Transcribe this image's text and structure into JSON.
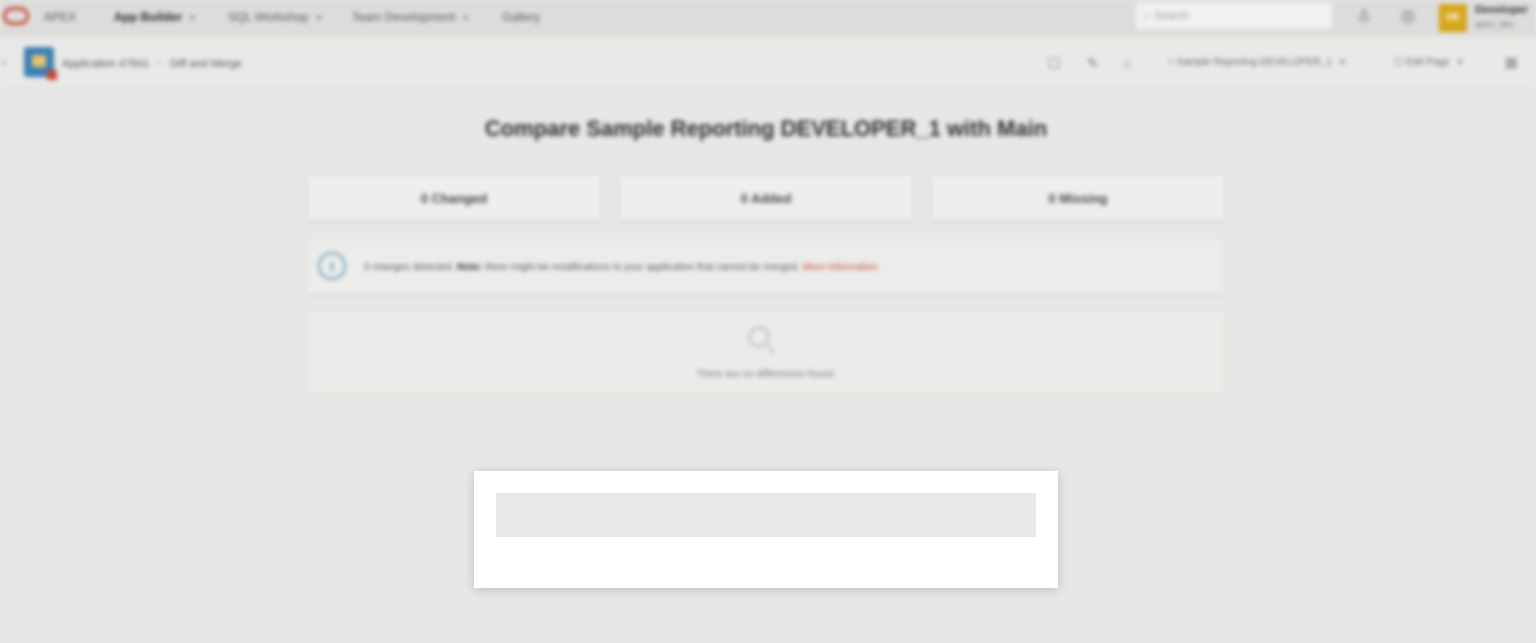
{
  "topnav": {
    "brand": "APEX",
    "items": [
      {
        "label": "App Builder",
        "active": true
      },
      {
        "label": "SQL Workshop",
        "active": false
      },
      {
        "label": "Team Development",
        "active": false
      },
      {
        "label": "Gallery",
        "active": false
      }
    ],
    "search_placeholder": "Search",
    "user": {
      "initials": "DE",
      "name": "Developer",
      "sub": "apex_dev"
    }
  },
  "toolbar": {
    "breadcrumb": [
      "Application 47841",
      "Diff and Merge"
    ],
    "working_copy": "Sample Reporting DEVELOPER_1",
    "page_button": "Edit Page"
  },
  "main": {
    "title": "Compare Sample Reporting DEVELOPER_1 with Main",
    "stats": [
      {
        "label": "0 Changed"
      },
      {
        "label": "0 Added"
      },
      {
        "label": "0 Missing"
      }
    ],
    "info": {
      "prefix": "0 changes detected.",
      "note_label": "Note:",
      "message": "there might be modifications to your application that cannot be merged.",
      "link": "More information"
    },
    "empty_message": "There are no differences found."
  },
  "colors": {
    "accent": "#c74634",
    "info": "#4a85a8",
    "avatar": "#d6a61d",
    "app_icon": "#3b7fb5"
  }
}
